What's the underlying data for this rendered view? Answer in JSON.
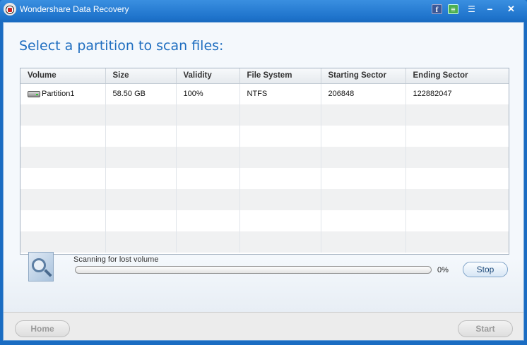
{
  "window": {
    "title": "Wondershare Data Recovery",
    "titlebar_icons": [
      "facebook-icon",
      "chat-icon",
      "menu-icon",
      "minimize-icon",
      "close-icon"
    ],
    "facebook_glyph": "f",
    "chat_glyph": "≡",
    "menu_glyph": "☰",
    "minimize_glyph": "−",
    "close_glyph": "✕"
  },
  "main": {
    "heading": "Select a partition to scan files:",
    "table": {
      "columns": [
        "Volume",
        "Size",
        "Validity",
        "File System",
        "Starting Sector",
        "Ending Sector"
      ],
      "rows": [
        {
          "volume": "Partition1",
          "size": "58.50 GB",
          "validity": "100%",
          "file_system": "NTFS",
          "starting_sector": "206848",
          "ending_sector": "122882047"
        }
      ]
    }
  },
  "scan": {
    "status": "Scanning for lost volume",
    "progress_percent": 0,
    "progress_text": "0%",
    "stop_label": "Stop"
  },
  "footer": {
    "home_label": "Home",
    "start_label": "Start"
  },
  "colors": {
    "titlebar": "#1f74cc",
    "heading": "#1f6ec0",
    "progress_fill": "#3f9c2a"
  }
}
